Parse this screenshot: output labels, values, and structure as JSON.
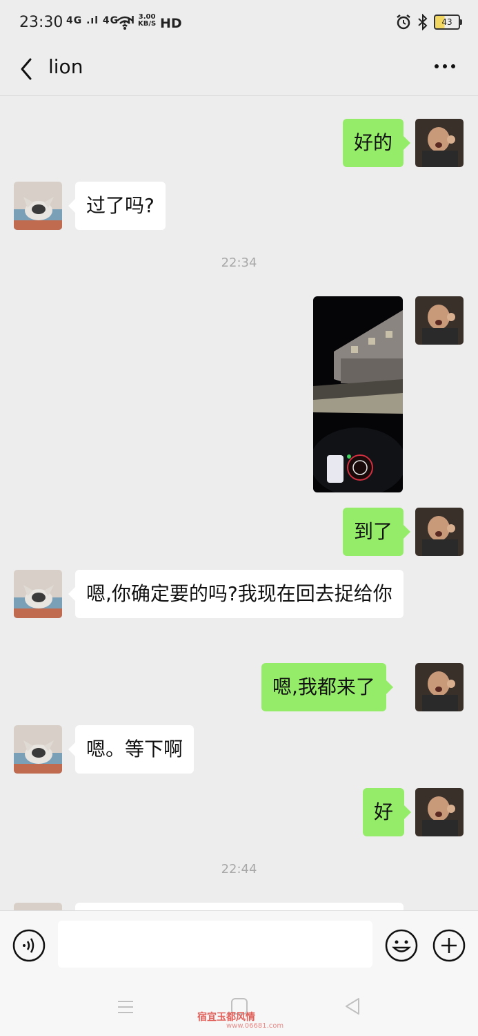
{
  "status_bar": {
    "time": "23:30",
    "network": "4G .ıl 4G .ıl",
    "speed_value": "3.00",
    "speed_unit": "KB/S",
    "hd": "HD",
    "battery": "43"
  },
  "header": {
    "title": "lion"
  },
  "messages": [
    {
      "side": "me",
      "type": "text",
      "text": "好的"
    },
    {
      "side": "other",
      "type": "text",
      "text": "过了吗?"
    },
    {
      "type": "timestamp",
      "text": "22:34"
    },
    {
      "side": "me",
      "type": "image"
    },
    {
      "side": "me",
      "type": "text",
      "text": "到了"
    },
    {
      "side": "other",
      "type": "text",
      "text": "嗯,你确定要的吗?我现在回去捉给你"
    },
    {
      "side": "me",
      "type": "text",
      "text": "嗯,我都来了"
    },
    {
      "side": "other",
      "type": "text",
      "text": "嗯。等下啊"
    },
    {
      "side": "me",
      "type": "text",
      "text": "好"
    },
    {
      "type": "timestamp",
      "text": "22:44"
    }
  ],
  "input": {
    "value": "",
    "placeholder": ""
  },
  "watermark": {
    "text": "宿宜玉都风情",
    "url": "www.06681.com"
  },
  "colors": {
    "my_bubble": "#95ec69",
    "other_bubble": "#ffffff",
    "background": "#ededed"
  },
  "icons": [
    "back-arrow-icon",
    "more-dots-icon",
    "voice-icon",
    "emoji-icon",
    "plus-icon",
    "nav-menu-icon",
    "nav-home-icon",
    "nav-back-icon",
    "alarm-icon",
    "bluetooth-icon",
    "wifi-icon"
  ]
}
